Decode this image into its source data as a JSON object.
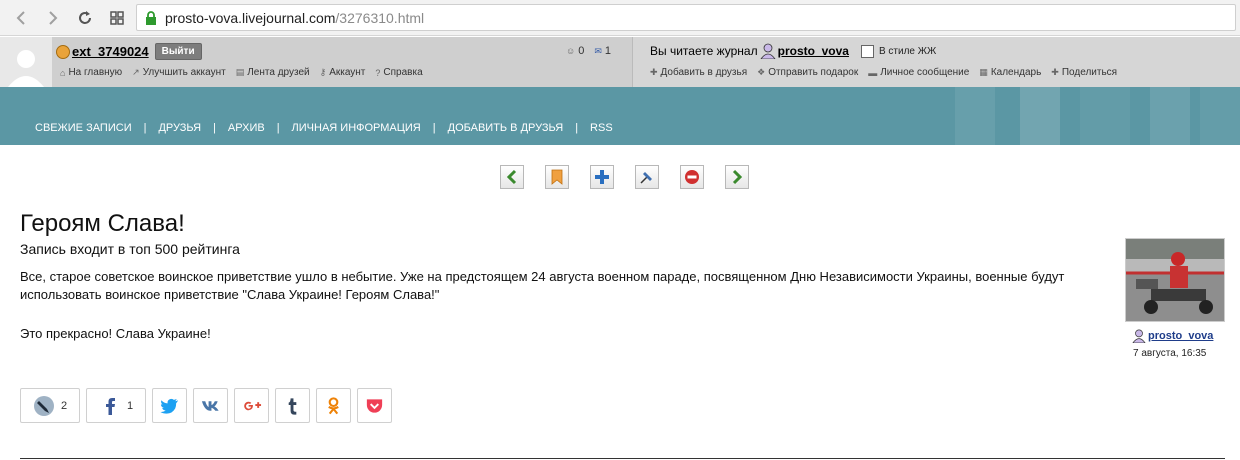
{
  "browser": {
    "url_host": "prosto-vova.livejournal.com",
    "url_path": "/3276310.html"
  },
  "lj_bar": {
    "username": "ext_3749024",
    "logout_label": "Выйти",
    "counter_comments": "0",
    "counter_messages": "1",
    "menu": [
      "На главную",
      "Улучшить аккаунт",
      "Лента друзей",
      "Аккаунт",
      "Справка"
    ],
    "reading_label": "Вы читаете журнал",
    "journal_user": "prosto_vova",
    "style_label": "В стиле ЖЖ",
    "right_menu": [
      "Добавить в друзья",
      "Отправить подарок",
      "Личное сообщение",
      "Календарь",
      "Поделиться"
    ]
  },
  "header": {
    "nav": [
      "СВЕЖИЕ ЗАПИСИ",
      "ДРУЗЬЯ",
      "АРХИВ",
      "ЛИЧНАЯ ИНФОРМАЦИЯ",
      "ДОБАВИТЬ В ДРУЗЬЯ",
      "RSS"
    ],
    "separator": "|"
  },
  "post": {
    "title": "Героям Слава!",
    "subtitle": "Запись входит в топ 500 рейтинга",
    "body": "Все, старое советское воинское приветствие ушло в небытие. Уже на предстоящем 24 августа военном параде, посвященном Дню Независимости Украины, военные будут использовать воинское приветствие \"Слава Украине!  Героям Слава!\"",
    "body2": "Это прекрасно! Слава Украине!",
    "author": "prosto_vova",
    "date": "7 августа, 16:35"
  },
  "shares": {
    "lj_count": "2",
    "fb_count": "1"
  },
  "colors": {
    "teal": "#5b97a4",
    "vk": "#4a76a8",
    "twitter": "#1da1f2",
    "facebook": "#3b5998",
    "gplus": "#dd4b39",
    "tumblr": "#35465c",
    "ok": "#ee8208",
    "pocket": "#ef3f56"
  }
}
